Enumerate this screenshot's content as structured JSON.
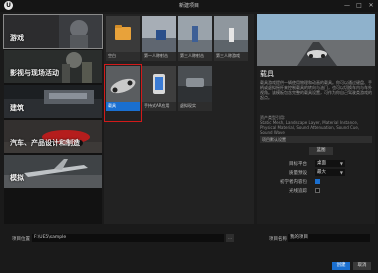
{
  "window": {
    "logo": "U",
    "title": "新建项目",
    "minimize": "—",
    "maximize": "□",
    "close": "✕"
  },
  "categories": [
    {
      "label": "游戏"
    },
    {
      "label": "影视与现场活动"
    },
    {
      "label": "建筑"
    },
    {
      "label": "汽车、产品设计和制造"
    },
    {
      "label": "模拟"
    }
  ],
  "templates": [
    {
      "label": "空白"
    },
    {
      "label": "第一人称射击"
    },
    {
      "label": "第三人称射击"
    },
    {
      "label": "第三人称游戏"
    },
    {
      "label": "载具"
    },
    {
      "label": "手持式AR应用"
    },
    {
      "label": "虚拟现实"
    }
  ],
  "details": {
    "title": "载具",
    "description": "载具游戏提供一辆使用物理和动画的载具。你可以通过键盘、手柄或虚拟摇杆来控制载具的转向与油门，也可以切换车内与车外视角。该模板包含完整的载具设置，可作为你自己驾驶类游戏的起点。",
    "assets_heading": "资产类型引用:",
    "assets": "Static Mesh, Landscape Layer, Material Instance, Physical Material, Sound Attenuation, Sound Cue, Sound Wave",
    "default_settings_button": "项目默认设置",
    "section_title": "蓝图",
    "settings": [
      {
        "label": "目标平台",
        "value": "桌面"
      },
      {
        "label": "质量预设",
        "value": "最大"
      }
    ],
    "checkboxes": [
      {
        "label": "初学者内容包",
        "checked": true
      },
      {
        "label": "光线追踪",
        "checked": false
      }
    ]
  },
  "bottom": {
    "location_label": "项目位置",
    "location_value": "F:\\UE5\\sample",
    "browse_label": "…",
    "name_label": "项目名称",
    "name_value": "我的项目",
    "create_label": "创建",
    "cancel_label": "取消"
  }
}
